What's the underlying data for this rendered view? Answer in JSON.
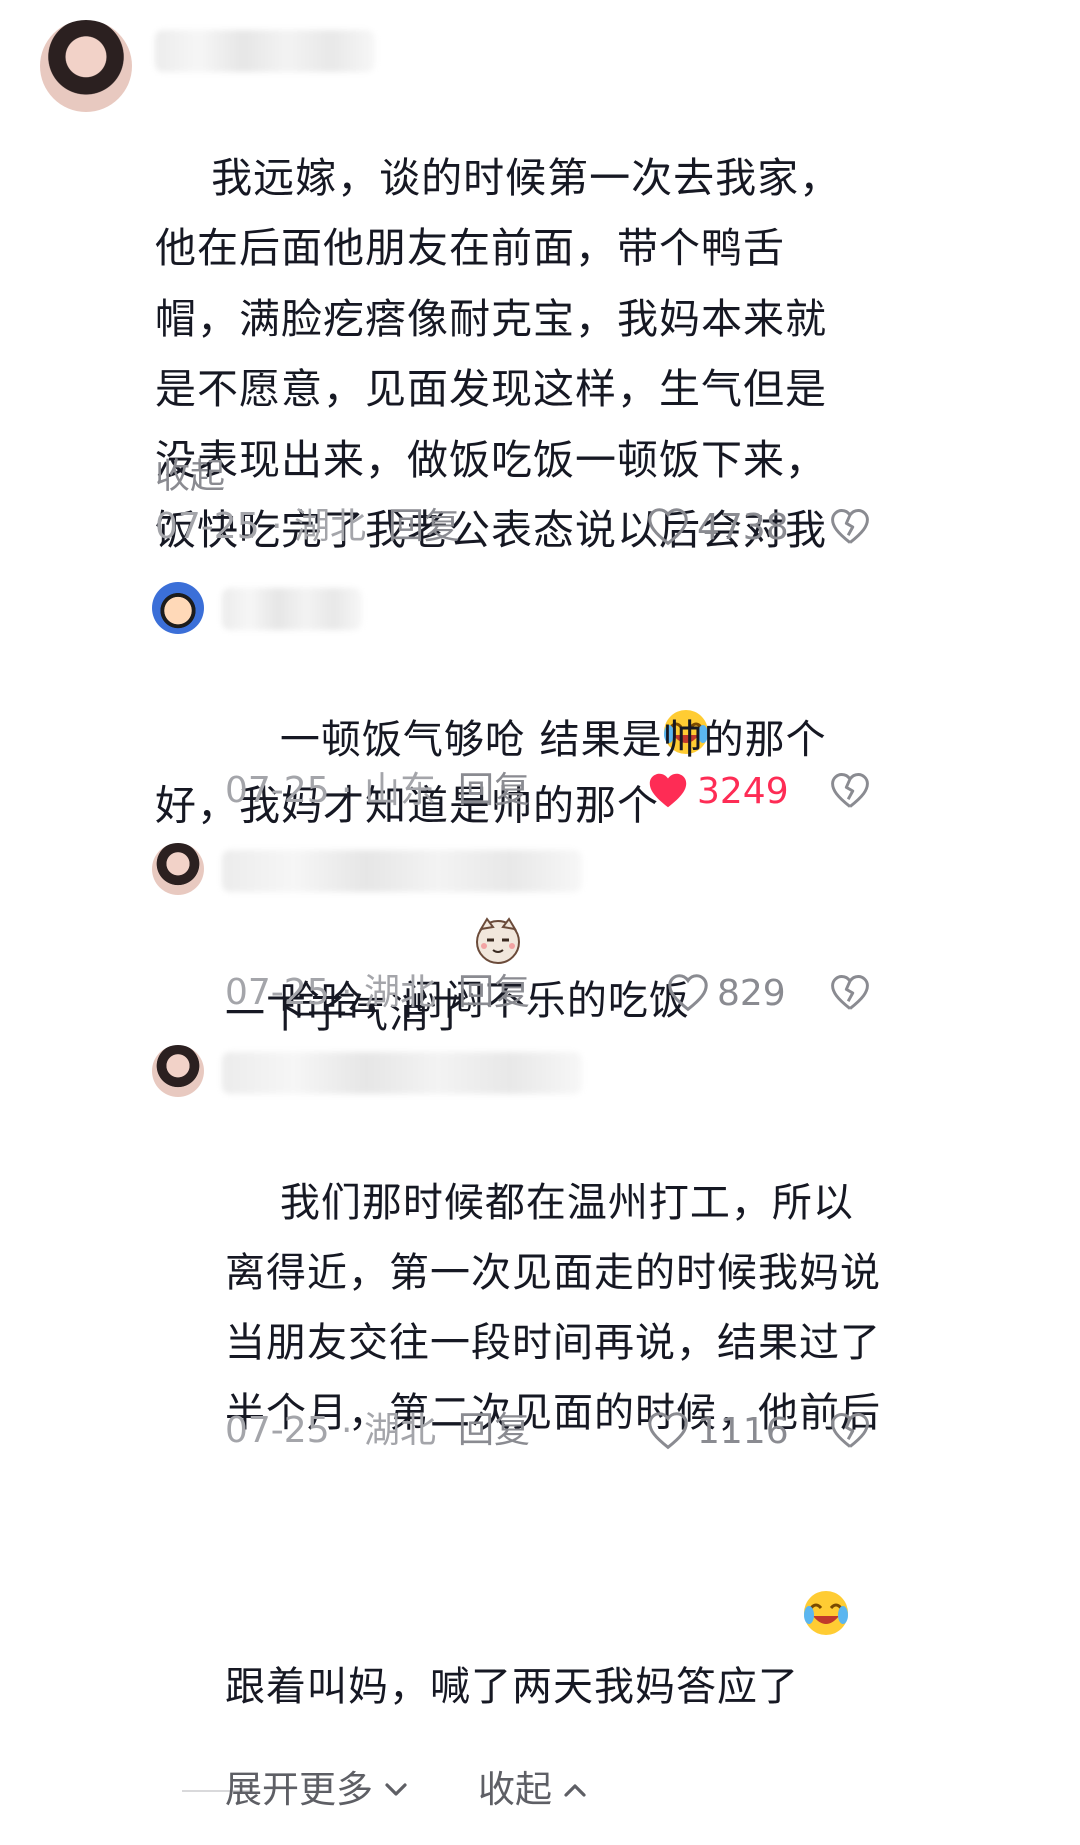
{
  "comments": [
    {
      "text": "我远嫁，谈的时候第一次去我家，他在后面他朋友在前面，带个鸭舌帽，满脸疙瘩像耐克宝，我妈本来就是不愿意，见面发现这样，生气但是没表现出来，做饭吃饭一顿饭下来，饭快吃完了我老公表态说以后会对我好，我妈才知道是帅的那个",
      "emoji": "laugh-cry-emoji",
      "collapse_label": "收起",
      "date_location": "07-25 · 湖北",
      "reply_label": "回复",
      "likes": "4738",
      "liked": false
    }
  ],
  "replies": [
    {
      "text": "一顿饭气够呛 结果是帅的那个 一下子气消了",
      "emoji": "smug-cat-emoji",
      "date_location": "07-25 · 山东",
      "reply_label": "回复",
      "likes": "3249",
      "liked": true
    },
    {
      "text": "哈哈，闷闷不乐的吃饭",
      "date_location": "07-25 · 湖北",
      "reply_label": "回复",
      "likes": "829",
      "liked": false
    },
    {
      "text": "我们那时候都在温州打工，所以离得近，第一次见面走的时候我妈说当朋友交往一段时间再说，结果过了半个月，第二次见面的时候，他前后跟着叫妈，喊了两天我妈答应了",
      "emoji": "laugh-cry-emoji",
      "date_location": "07-25 · 湖北",
      "reply_label": "回复",
      "likes": "1116",
      "liked": false
    }
  ],
  "footer": {
    "expand_label": "展开更多",
    "collapse_label": "收起"
  },
  "colors": {
    "like_active": "#fe2c55",
    "meta_text": "#a4a5aa"
  }
}
